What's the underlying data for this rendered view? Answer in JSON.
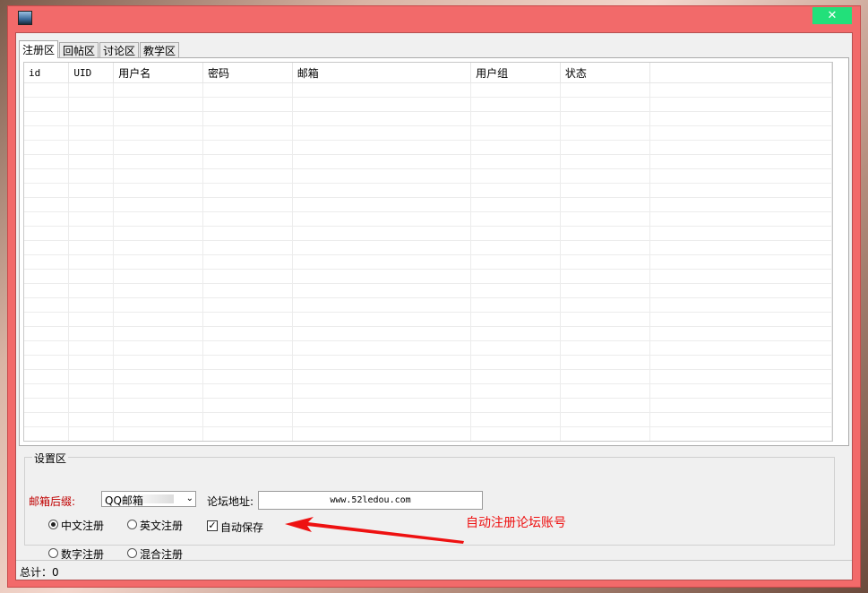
{
  "window": {
    "close_glyph": "✕"
  },
  "tabs": [
    "注册区",
    "回帖区",
    "讨论区",
    "教学区"
  ],
  "grid": {
    "columns": [
      "id",
      "UID",
      "用户名",
      "密码",
      "邮箱",
      "用户组",
      "状态"
    ],
    "rows": []
  },
  "settings": {
    "legend": "设置区",
    "mail_suffix_label": "邮箱后缀:",
    "mail_suffix_value": "QQ邮箱",
    "forum_url_label": "论坛地址:",
    "forum_url_value": "www.52ledou.com",
    "radios": [
      {
        "label": "中文注册",
        "checked": true
      },
      {
        "label": "英文注册",
        "checked": false
      },
      {
        "label": "数字注册",
        "checked": false
      },
      {
        "label": "混合注册",
        "checked": false
      }
    ],
    "autosave_label": "自动保存",
    "autosave_checked": true
  },
  "annotation": "自动注册论坛账号",
  "status": "总计：0",
  "colors": {
    "titlebar": "#f26a6a",
    "close_button": "#22e07a",
    "annotation": "#ee1111"
  }
}
